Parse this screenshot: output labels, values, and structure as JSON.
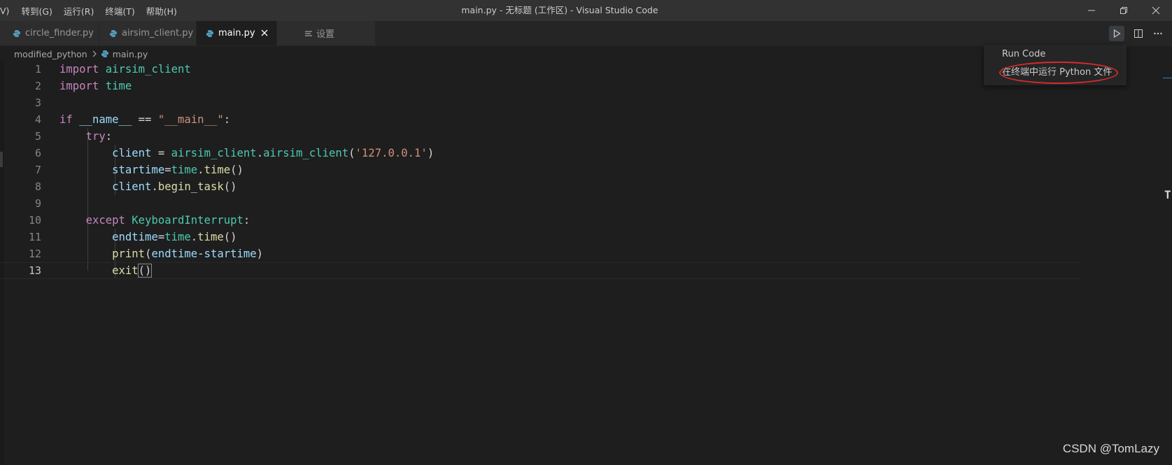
{
  "titlebar": {
    "menu": [
      "V)",
      "转到(G)",
      "运行(R)",
      "终端(T)",
      "帮助(H)"
    ],
    "title": "main.py - 无标题 (工作区) - Visual Studio Code"
  },
  "tabs": [
    {
      "label": "circle_finder.py",
      "icon": "python-icon",
      "active": false
    },
    {
      "label": "airsim_client.py",
      "icon": "python-icon",
      "active": false
    },
    {
      "label": "main.py",
      "icon": "python-icon",
      "active": true
    },
    {
      "label": "设置",
      "icon": "settings-list-icon",
      "active": false
    }
  ],
  "breadcrumb": {
    "folder": "modified_python",
    "file": "main.py"
  },
  "editor": {
    "line_numbers": [
      "1",
      "2",
      "3",
      "4",
      "5",
      "6",
      "7",
      "8",
      "9",
      "10",
      "11",
      "12",
      "13"
    ],
    "current_line": 13,
    "lines": [
      "import airsim_client",
      "import time",
      "",
      "if __name__ == \"__main__\":",
      "    try:",
      "        client = airsim_client.airsim_client('127.0.0.1')",
      "        startime=time.time()",
      "        client.begin_task()",
      "",
      "    except KeyboardInterrupt:",
      "        endtime=time.time()",
      "        print(endtime-startime)",
      "        exit()"
    ]
  },
  "run_menu": {
    "items": [
      "Run Code",
      "在终端中运行 Python 文件"
    ],
    "highlighted_item": "在终端中运行 Python 文件",
    "highlight_color": "#d62b2b"
  },
  "watermark": "CSDN @TomLazy",
  "colors": {
    "keyword": "#c586c0",
    "module": "#4ec9b0",
    "variable": "#9cdcfe",
    "function": "#dcdcaa",
    "string": "#ce9178",
    "python_icon": "#519aba"
  }
}
